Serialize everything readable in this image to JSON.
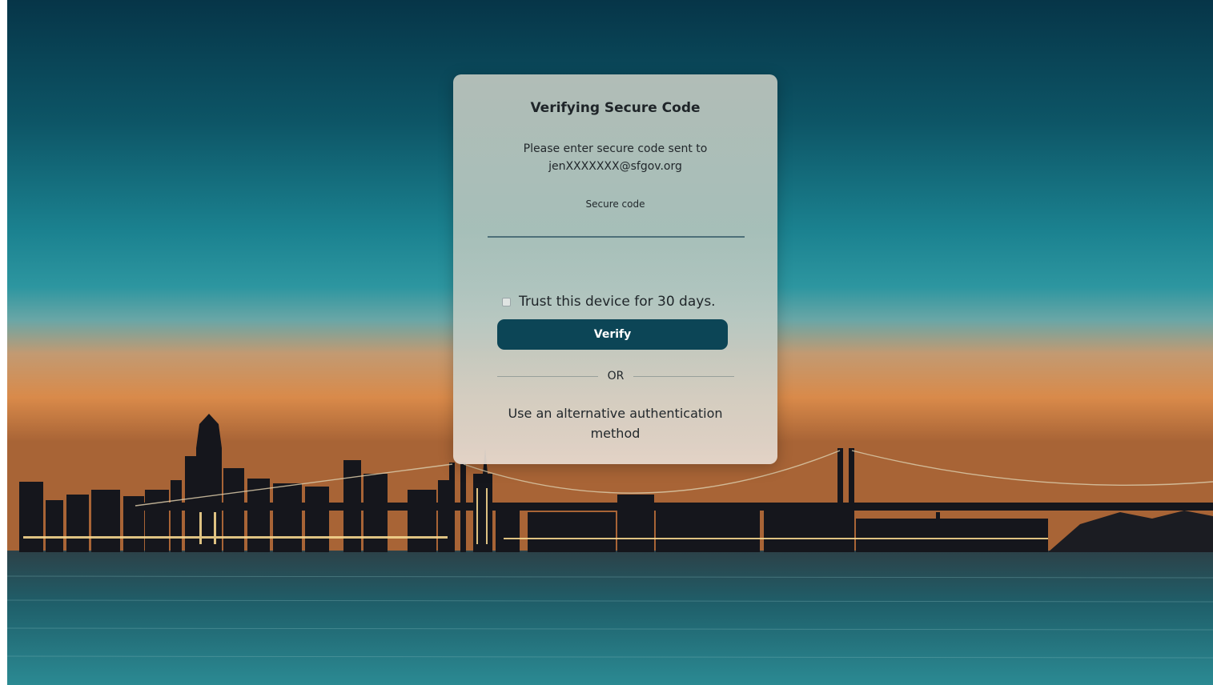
{
  "dialog": {
    "title": "Verifying Secure Code",
    "instruction_line1": "Please enter secure code sent to",
    "instruction_line2": "jenXXXXXXX@sfgov.org",
    "code_label": "Secure code",
    "code_value": "",
    "trust_label": "Trust this device for 30 days.",
    "trust_checked": false,
    "verify_label": "Verify",
    "or_label": "OR",
    "alt_link_label": "Use an alternative authentication method"
  },
  "colors": {
    "primary_button": "#0c4556",
    "input_underline": "#4d6f79"
  }
}
